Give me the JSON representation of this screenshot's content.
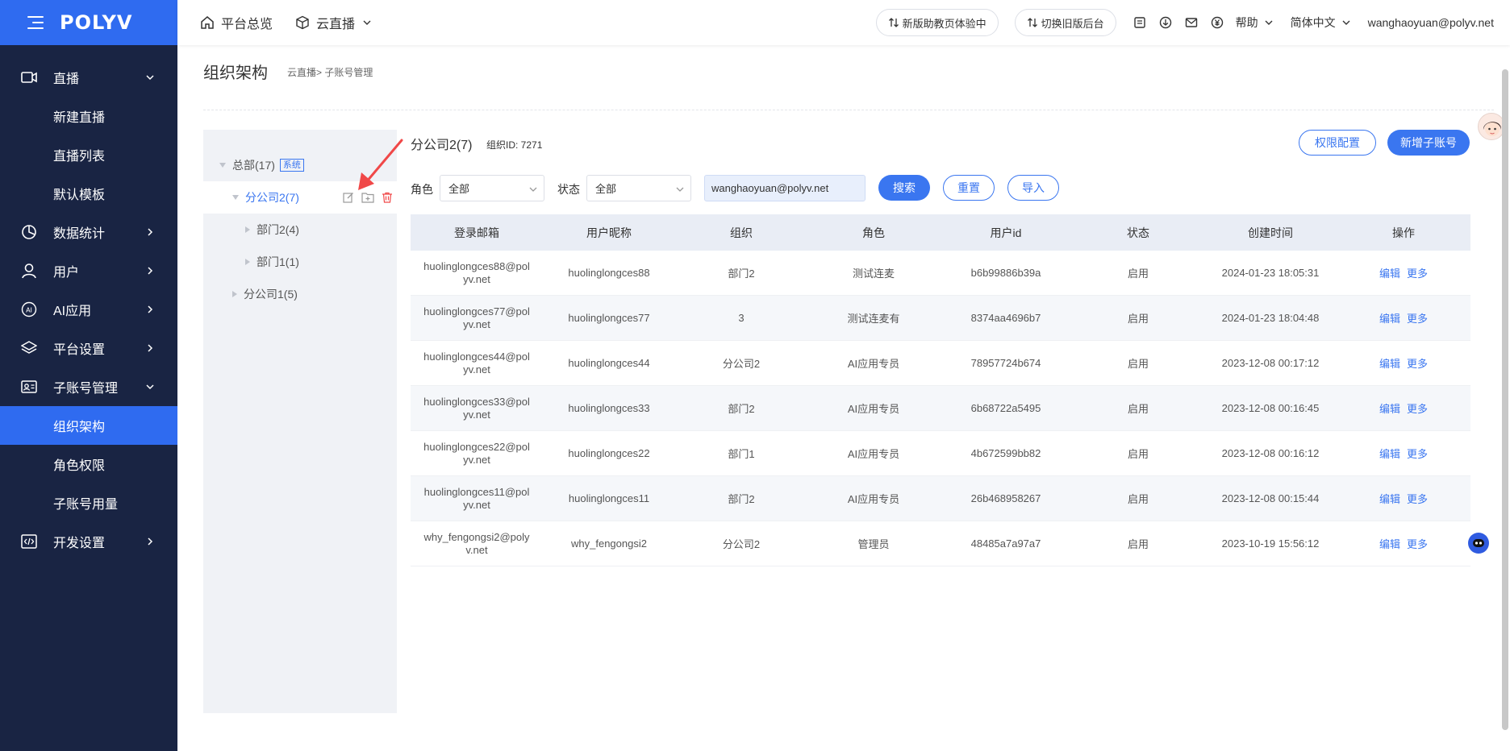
{
  "brand": {
    "logo": "POLYV"
  },
  "sidebar": {
    "items": [
      {
        "label": "直播",
        "icon": "video-icon",
        "expanded": true
      },
      {
        "label": "新建直播",
        "sub": true
      },
      {
        "label": "直播列表",
        "sub": true
      },
      {
        "label": "默认模板",
        "sub": true
      },
      {
        "label": "数据统计",
        "icon": "pie-chart-icon"
      },
      {
        "label": "用户",
        "icon": "user-icon"
      },
      {
        "label": "AI应用",
        "icon": "ai-icon"
      },
      {
        "label": "平台设置",
        "icon": "layers-icon"
      },
      {
        "label": "子账号管理",
        "icon": "id-card-icon",
        "expanded": true
      },
      {
        "label": "组织架构",
        "sub": true,
        "active": true
      },
      {
        "label": "角色权限",
        "sub": true
      },
      {
        "label": "子账号用量",
        "sub": true
      },
      {
        "label": "开发设置",
        "icon": "code-icon"
      }
    ]
  },
  "topbar": {
    "home": "平台总览",
    "cloud_live": "云直播",
    "new_version": "新版助教页体验中",
    "switch_old": "切换旧版后台",
    "help": "帮助",
    "language": "简体中文",
    "user_email": "wanghaoyuan@polyv.net"
  },
  "page": {
    "title": "组织架构",
    "breadcrumb": "云直播>  子账号管理"
  },
  "tree": {
    "root": {
      "label": "总部(17)",
      "tag": "系统"
    },
    "selected": "分公司2(7)",
    "children": [
      "部门2(4)",
      "部门1(1)"
    ],
    "other": "分公司1(5)"
  },
  "content": {
    "org_name": "分公司2(7)",
    "org_id": "组织ID: 7271",
    "perm_button": "权限配置",
    "add_button": "新增子账号",
    "filters": {
      "role_label": "角色",
      "role_value": "全部",
      "status_label": "状态",
      "status_value": "全部",
      "search_value": "wanghaoyuan@polyv.net",
      "search_button": "搜索",
      "reset_button": "重置",
      "import_button": "导入"
    }
  },
  "table": {
    "headers": [
      "登录邮箱",
      "用户昵称",
      "组织",
      "角色",
      "用户id",
      "状态",
      "创建时间",
      "操作"
    ],
    "edit_label": "编辑",
    "more_label": "更多",
    "rows": [
      {
        "email1": "huolinglongces88@pol",
        "email2": "yv.net",
        "nick": "huolinglongces88",
        "org": "部门2",
        "role": "测试连麦",
        "uid": "b6b99886b39a",
        "status": "启用",
        "time": "2024-01-23 18:05:31"
      },
      {
        "email1": "huolinglongces77@pol",
        "email2": "yv.net",
        "nick": "huolinglongces77",
        "org": "3",
        "role": "测试连麦有",
        "uid": "8374aa4696b7",
        "status": "启用",
        "time": "2024-01-23 18:04:48"
      },
      {
        "email1": "huolinglongces44@pol",
        "email2": "yv.net",
        "nick": "huolinglongces44",
        "org": "分公司2",
        "role": "AI应用专员",
        "uid": "78957724b674",
        "status": "启用",
        "time": "2023-12-08 00:17:12"
      },
      {
        "email1": "huolinglongces33@pol",
        "email2": "yv.net",
        "nick": "huolinglongces33",
        "org": "部门2",
        "role": "AI应用专员",
        "uid": "6b68722a5495",
        "status": "启用",
        "time": "2023-12-08 00:16:45"
      },
      {
        "email1": "huolinglongces22@pol",
        "email2": "yv.net",
        "nick": "huolinglongces22",
        "org": "部门1",
        "role": "AI应用专员",
        "uid": "4b672599bb82",
        "status": "启用",
        "time": "2023-12-08 00:16:12"
      },
      {
        "email1": "huolinglongces11@pol",
        "email2": "yv.net",
        "nick": "huolinglongces11",
        "org": "部门2",
        "role": "AI应用专员",
        "uid": "26b468958267",
        "status": "启用",
        "time": "2023-12-08 00:15:44"
      },
      {
        "email1": "why_fengongsi2@poly",
        "email2": "v.net",
        "nick": "why_fengongsi2",
        "org": "分公司2",
        "role": "管理员",
        "uid": "48485a7a97a7",
        "status": "启用",
        "time": "2023-10-19 15:56:12"
      }
    ]
  },
  "colors": {
    "sidebar_bg": "#192443",
    "primary": "#3a76f0",
    "active_bg": "#2f6bf0",
    "delete_red": "#f04848"
  }
}
